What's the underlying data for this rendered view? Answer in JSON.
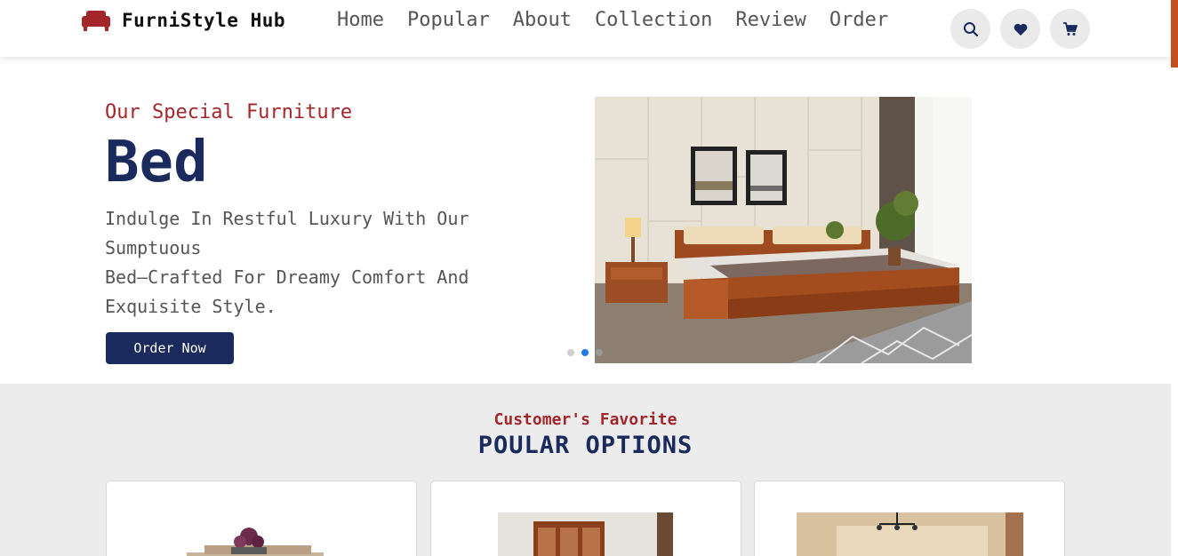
{
  "brand": {
    "name": "FurniStyle Hub",
    "logo_icon": "sofa-icon",
    "accent": "#a3262a"
  },
  "nav": {
    "items": [
      {
        "label": "Home"
      },
      {
        "label": "Popular"
      },
      {
        "label": "About"
      },
      {
        "label": "Collection"
      },
      {
        "label": "Review"
      },
      {
        "label": "Order"
      }
    ]
  },
  "header_icons": [
    "search-icon",
    "heart-icon",
    "cart-icon"
  ],
  "hero": {
    "subtitle": "Our Special Furniture",
    "title": "Bed",
    "description_line1": "Indulge In Restful Luxury With Our Sumptuous",
    "description_line2": "Bed—Crafted For Dreamy Comfort And Exquisite Style.",
    "cta_label": "Order Now",
    "carousel_active_index": 1,
    "carousel_count": 3
  },
  "popular": {
    "subtitle": "Customer's Favorite",
    "title": "POULAR OPTIONS"
  },
  "colors": {
    "primary": "#1a2a5c",
    "accent": "#a3262a",
    "dot_active": "#1e7ae8",
    "section_bg": "#ececec"
  }
}
